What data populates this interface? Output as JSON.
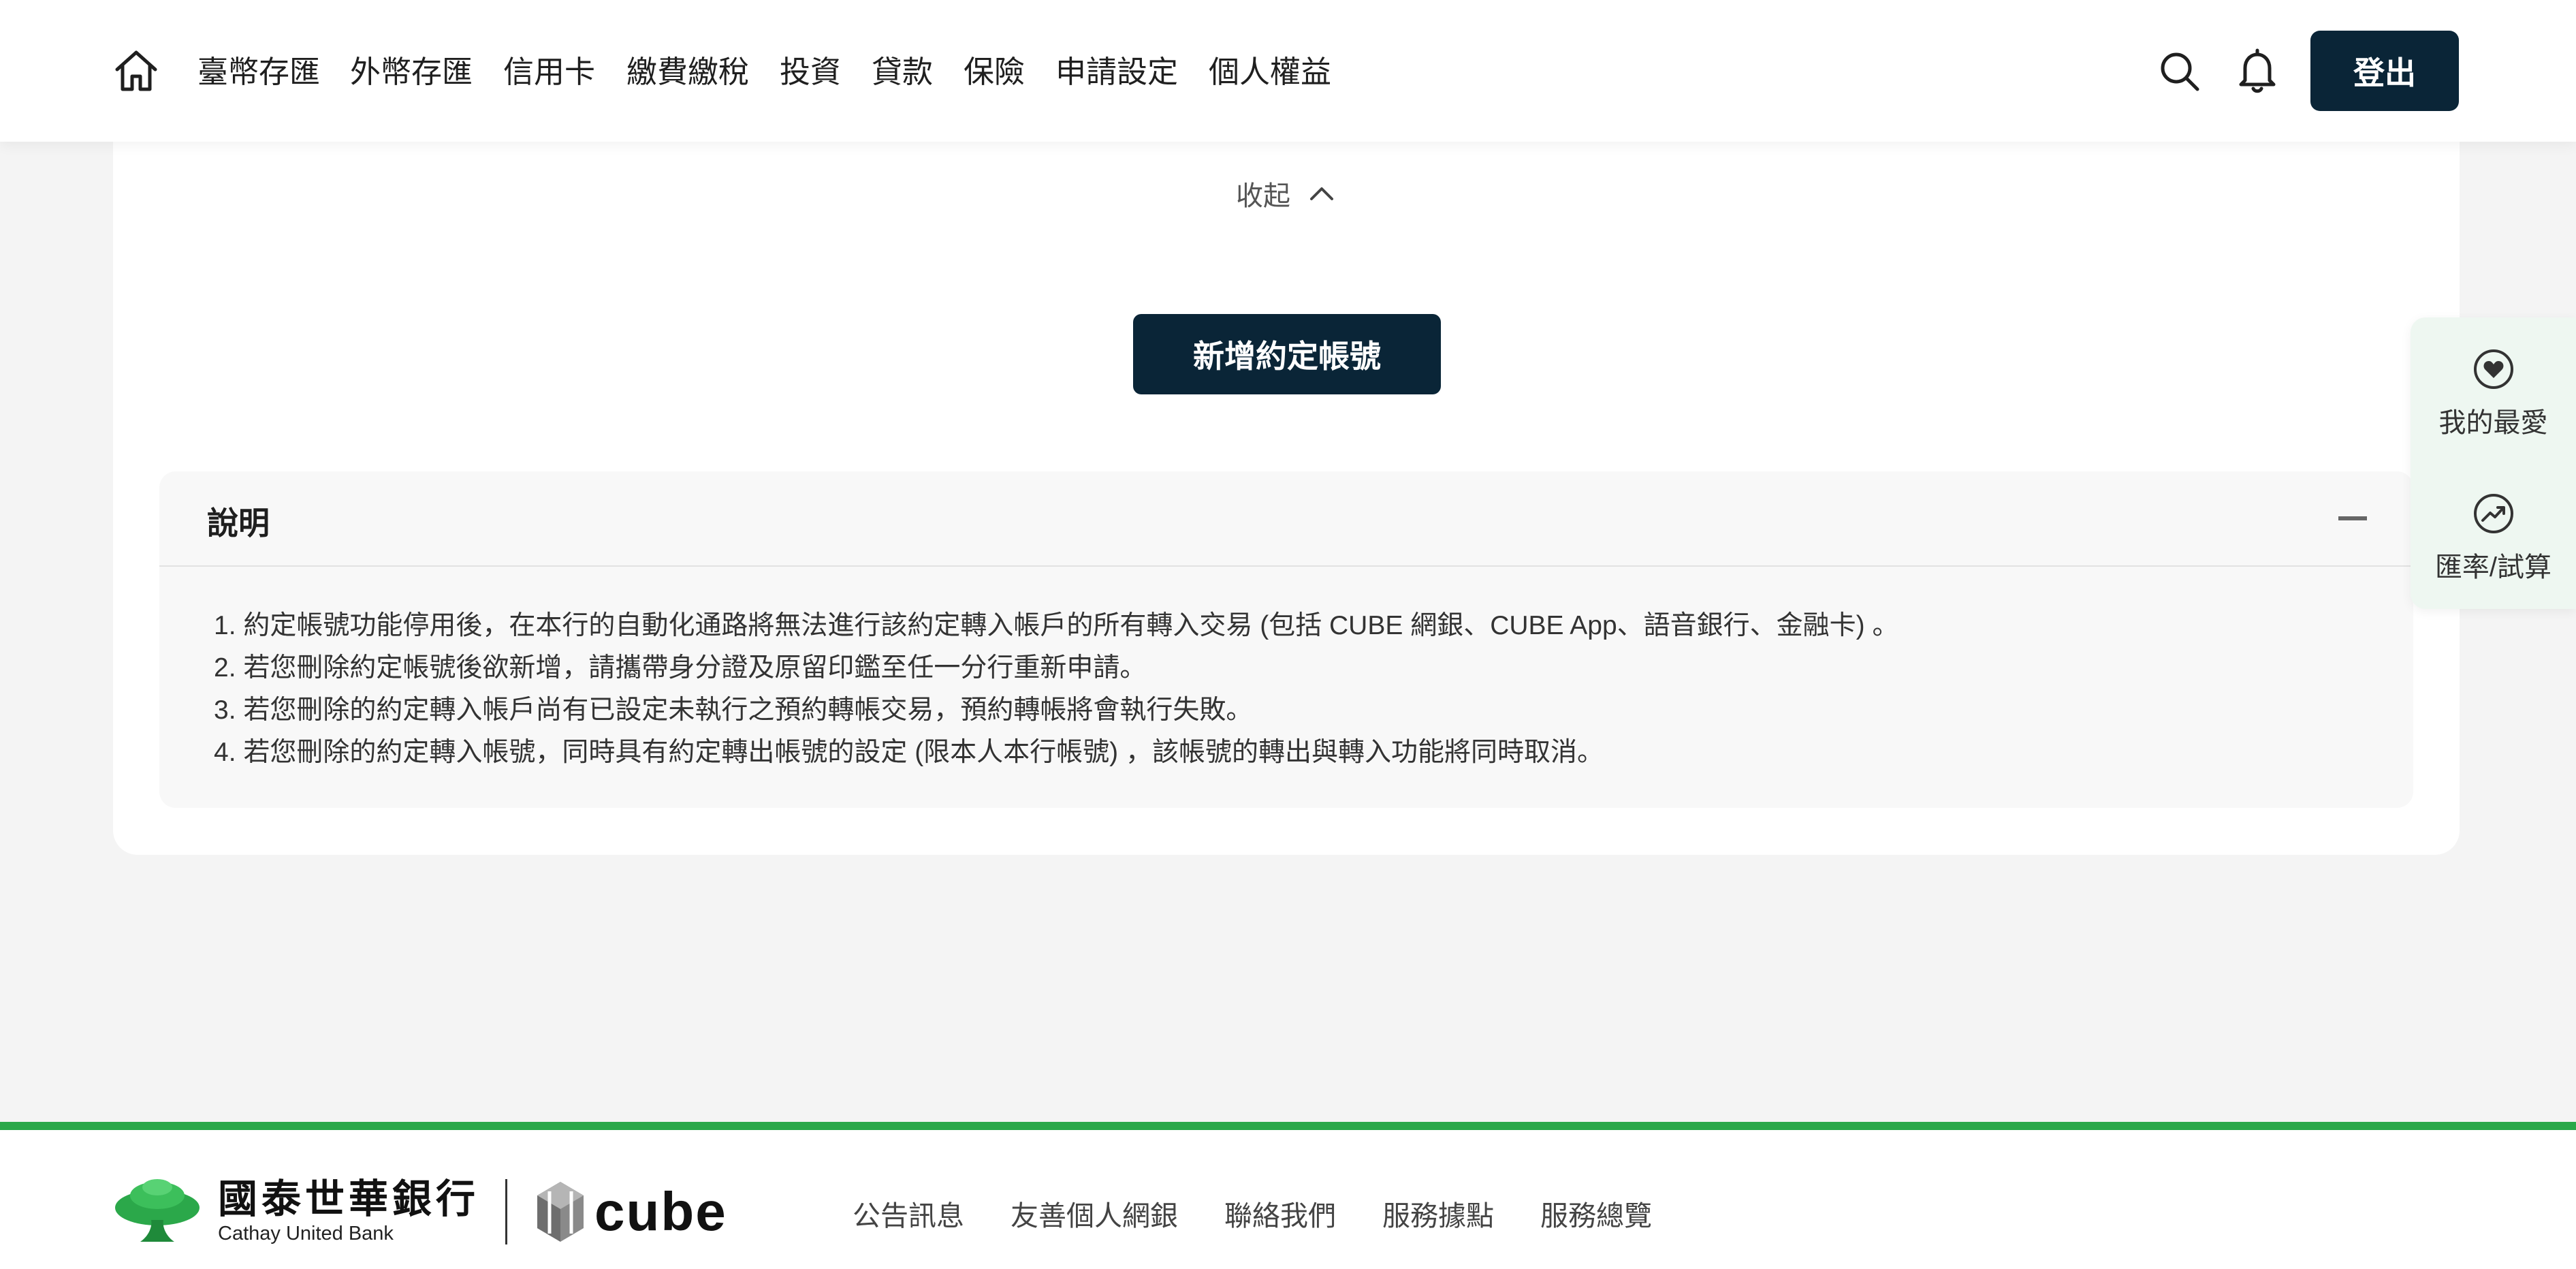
{
  "header": {
    "nav": [
      "臺幣存匯",
      "外幣存匯",
      "信用卡",
      "繳費繳稅",
      "投資",
      "貸款",
      "保險",
      "申請設定",
      "個人權益"
    ],
    "logout_label": "登出"
  },
  "main": {
    "collapse_label": "收起",
    "add_button_label": "新增約定帳號",
    "notes": {
      "title": "說明",
      "items": [
        "1. 約定帳號功能停用後，在本行的自動化通路將無法進行該約定轉入帳戶的所有轉入交易 (包括 CUBE 網銀、CUBE App、語音銀行、金融卡) 。",
        "2. 若您刪除約定帳號後欲新增，請攜帶身分證及原留印鑑至任一分行重新申請。",
        "3. 若您刪除的約定轉入帳戶尚有已設定未執行之預約轉帳交易，預約轉帳將會執行失敗。",
        "4. 若您刪除的約定轉入帳號，同時具有約定轉出帳號的設定 (限本人本行帳號) ，該帳號的轉出與轉入功能將同時取消。"
      ]
    }
  },
  "side_panel": {
    "favorites_label": "我的最愛",
    "exchange_label": "匯率/試算"
  },
  "footer": {
    "bank_name_zh": "國泰世華銀行",
    "bank_name_en": "Cathay United Bank",
    "cube_logo_text": "cube",
    "links": [
      "公告訊息",
      "友善個人網銀",
      "聯絡我們",
      "服務據點",
      "服務總覽"
    ]
  },
  "colors": {
    "primary_dark": "#0a2537",
    "brand_green": "#2ba84a",
    "page_bg": "#f4f4f4",
    "side_panel_bg": "#eef7f1"
  },
  "icons": [
    "home-icon",
    "search-icon",
    "bell-icon",
    "chevron-up-icon",
    "minus-icon",
    "heart-icon",
    "trend-up-icon",
    "cathay-tree-logo",
    "cube-logo-mark"
  ]
}
